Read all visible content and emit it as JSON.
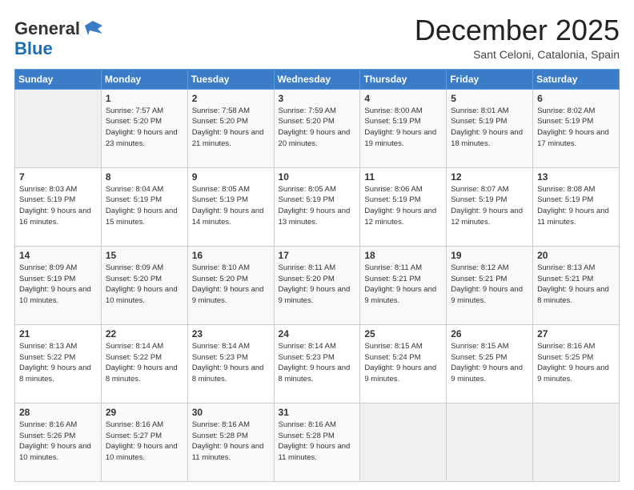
{
  "header": {
    "logo_general": "General",
    "logo_blue": "Blue",
    "month": "December 2025",
    "location": "Sant Celoni, Catalonia, Spain"
  },
  "days_of_week": [
    "Sunday",
    "Monday",
    "Tuesday",
    "Wednesday",
    "Thursday",
    "Friday",
    "Saturday"
  ],
  "weeks": [
    [
      {
        "day": "",
        "sunrise": "",
        "sunset": "",
        "daylight": ""
      },
      {
        "day": "1",
        "sunrise": "Sunrise: 7:57 AM",
        "sunset": "Sunset: 5:20 PM",
        "daylight": "Daylight: 9 hours and 23 minutes."
      },
      {
        "day": "2",
        "sunrise": "Sunrise: 7:58 AM",
        "sunset": "Sunset: 5:20 PM",
        "daylight": "Daylight: 9 hours and 21 minutes."
      },
      {
        "day": "3",
        "sunrise": "Sunrise: 7:59 AM",
        "sunset": "Sunset: 5:20 PM",
        "daylight": "Daylight: 9 hours and 20 minutes."
      },
      {
        "day": "4",
        "sunrise": "Sunrise: 8:00 AM",
        "sunset": "Sunset: 5:19 PM",
        "daylight": "Daylight: 9 hours and 19 minutes."
      },
      {
        "day": "5",
        "sunrise": "Sunrise: 8:01 AM",
        "sunset": "Sunset: 5:19 PM",
        "daylight": "Daylight: 9 hours and 18 minutes."
      },
      {
        "day": "6",
        "sunrise": "Sunrise: 8:02 AM",
        "sunset": "Sunset: 5:19 PM",
        "daylight": "Daylight: 9 hours and 17 minutes."
      }
    ],
    [
      {
        "day": "7",
        "sunrise": "Sunrise: 8:03 AM",
        "sunset": "Sunset: 5:19 PM",
        "daylight": "Daylight: 9 hours and 16 minutes."
      },
      {
        "day": "8",
        "sunrise": "Sunrise: 8:04 AM",
        "sunset": "Sunset: 5:19 PM",
        "daylight": "Daylight: 9 hours and 15 minutes."
      },
      {
        "day": "9",
        "sunrise": "Sunrise: 8:05 AM",
        "sunset": "Sunset: 5:19 PM",
        "daylight": "Daylight: 9 hours and 14 minutes."
      },
      {
        "day": "10",
        "sunrise": "Sunrise: 8:05 AM",
        "sunset": "Sunset: 5:19 PM",
        "daylight": "Daylight: 9 hours and 13 minutes."
      },
      {
        "day": "11",
        "sunrise": "Sunrise: 8:06 AM",
        "sunset": "Sunset: 5:19 PM",
        "daylight": "Daylight: 9 hours and 12 minutes."
      },
      {
        "day": "12",
        "sunrise": "Sunrise: 8:07 AM",
        "sunset": "Sunset: 5:19 PM",
        "daylight": "Daylight: 9 hours and 12 minutes."
      },
      {
        "day": "13",
        "sunrise": "Sunrise: 8:08 AM",
        "sunset": "Sunset: 5:19 PM",
        "daylight": "Daylight: 9 hours and 11 minutes."
      }
    ],
    [
      {
        "day": "14",
        "sunrise": "Sunrise: 8:09 AM",
        "sunset": "Sunset: 5:19 PM",
        "daylight": "Daylight: 9 hours and 10 minutes."
      },
      {
        "day": "15",
        "sunrise": "Sunrise: 8:09 AM",
        "sunset": "Sunset: 5:20 PM",
        "daylight": "Daylight: 9 hours and 10 minutes."
      },
      {
        "day": "16",
        "sunrise": "Sunrise: 8:10 AM",
        "sunset": "Sunset: 5:20 PM",
        "daylight": "Daylight: 9 hours and 9 minutes."
      },
      {
        "day": "17",
        "sunrise": "Sunrise: 8:11 AM",
        "sunset": "Sunset: 5:20 PM",
        "daylight": "Daylight: 9 hours and 9 minutes."
      },
      {
        "day": "18",
        "sunrise": "Sunrise: 8:11 AM",
        "sunset": "Sunset: 5:21 PM",
        "daylight": "Daylight: 9 hours and 9 minutes."
      },
      {
        "day": "19",
        "sunrise": "Sunrise: 8:12 AM",
        "sunset": "Sunset: 5:21 PM",
        "daylight": "Daylight: 9 hours and 9 minutes."
      },
      {
        "day": "20",
        "sunrise": "Sunrise: 8:13 AM",
        "sunset": "Sunset: 5:21 PM",
        "daylight": "Daylight: 9 hours and 8 minutes."
      }
    ],
    [
      {
        "day": "21",
        "sunrise": "Sunrise: 8:13 AM",
        "sunset": "Sunset: 5:22 PM",
        "daylight": "Daylight: 9 hours and 8 minutes."
      },
      {
        "day": "22",
        "sunrise": "Sunrise: 8:14 AM",
        "sunset": "Sunset: 5:22 PM",
        "daylight": "Daylight: 9 hours and 8 minutes."
      },
      {
        "day": "23",
        "sunrise": "Sunrise: 8:14 AM",
        "sunset": "Sunset: 5:23 PM",
        "daylight": "Daylight: 9 hours and 8 minutes."
      },
      {
        "day": "24",
        "sunrise": "Sunrise: 8:14 AM",
        "sunset": "Sunset: 5:23 PM",
        "daylight": "Daylight: 9 hours and 8 minutes."
      },
      {
        "day": "25",
        "sunrise": "Sunrise: 8:15 AM",
        "sunset": "Sunset: 5:24 PM",
        "daylight": "Daylight: 9 hours and 9 minutes."
      },
      {
        "day": "26",
        "sunrise": "Sunrise: 8:15 AM",
        "sunset": "Sunset: 5:25 PM",
        "daylight": "Daylight: 9 hours and 9 minutes."
      },
      {
        "day": "27",
        "sunrise": "Sunrise: 8:16 AM",
        "sunset": "Sunset: 5:25 PM",
        "daylight": "Daylight: 9 hours and 9 minutes."
      }
    ],
    [
      {
        "day": "28",
        "sunrise": "Sunrise: 8:16 AM",
        "sunset": "Sunset: 5:26 PM",
        "daylight": "Daylight: 9 hours and 10 minutes."
      },
      {
        "day": "29",
        "sunrise": "Sunrise: 8:16 AM",
        "sunset": "Sunset: 5:27 PM",
        "daylight": "Daylight: 9 hours and 10 minutes."
      },
      {
        "day": "30",
        "sunrise": "Sunrise: 8:16 AM",
        "sunset": "Sunset: 5:28 PM",
        "daylight": "Daylight: 9 hours and 11 minutes."
      },
      {
        "day": "31",
        "sunrise": "Sunrise: 8:16 AM",
        "sunset": "Sunset: 5:28 PM",
        "daylight": "Daylight: 9 hours and 11 minutes."
      },
      {
        "day": "",
        "sunrise": "",
        "sunset": "",
        "daylight": ""
      },
      {
        "day": "",
        "sunrise": "",
        "sunset": "",
        "daylight": ""
      },
      {
        "day": "",
        "sunrise": "",
        "sunset": "",
        "daylight": ""
      }
    ]
  ]
}
